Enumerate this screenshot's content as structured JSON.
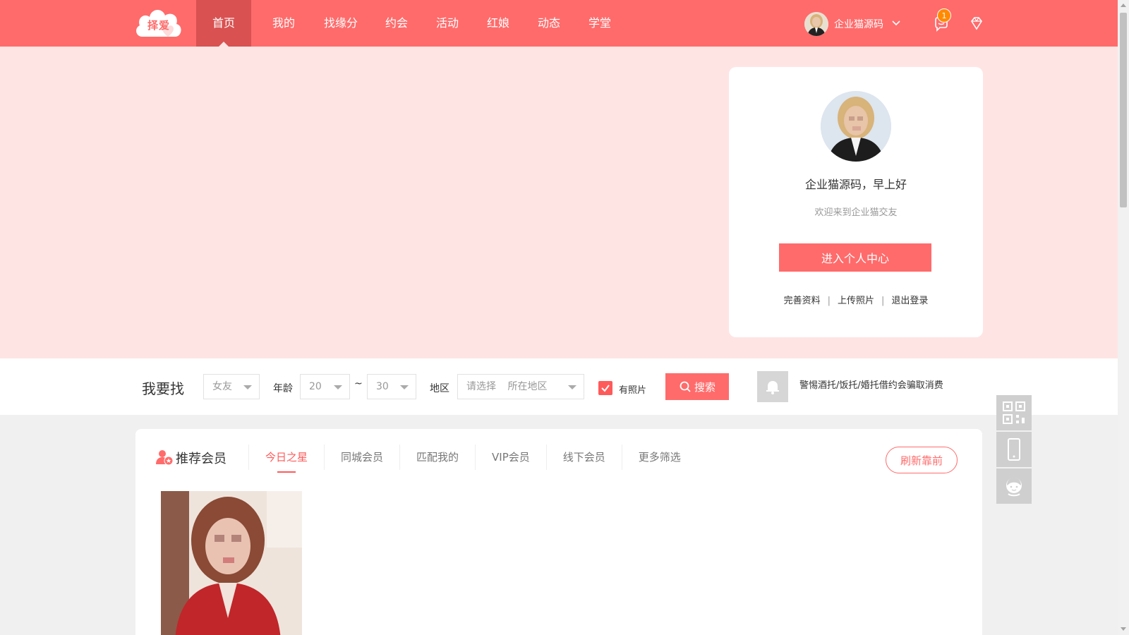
{
  "logo": {
    "text": "择爱"
  },
  "nav": {
    "items": [
      "首页",
      "我的",
      "找缘分",
      "约会",
      "活动",
      "红娘",
      "动态",
      "学堂"
    ],
    "active_index": 0
  },
  "user": {
    "name": "企业猫源码",
    "message_count": "1"
  },
  "profile_card": {
    "greeting": "企业猫源码，早上好",
    "welcome": "欢迎来到企业猫交友",
    "center_button": "进入个人中心",
    "links": [
      "完善资料",
      "上传照片",
      "退出登录"
    ],
    "separator": "|"
  },
  "search": {
    "title": "我要找",
    "gender": "女友",
    "age_label": "年龄",
    "age_min": "20",
    "age_tilde": "~",
    "age_max": "30",
    "region_label": "地区",
    "region_placeholder_1": "请选择",
    "region_placeholder_2": "所在地区",
    "has_photo_label": "有照片",
    "has_photo_checked": true,
    "search_button": "搜索",
    "warning": "警惕酒托/饭托/婚托借约会骗取消费"
  },
  "members": {
    "title": "推荐会员",
    "tabs": [
      "今日之星",
      "同城会员",
      "匹配我的",
      "VIP会员",
      "线下会员",
      "更多筛选"
    ],
    "active_tab": 0,
    "refresh_button": "刷新靠前"
  },
  "float_tools": [
    "qrcode-icon",
    "phone-icon",
    "customer-service-icon"
  ],
  "colors": {
    "brand": "#ff6b6b",
    "nav_active": "#d95151",
    "hero_bg": "#ffe4e4",
    "badge": "#ff8a00"
  }
}
